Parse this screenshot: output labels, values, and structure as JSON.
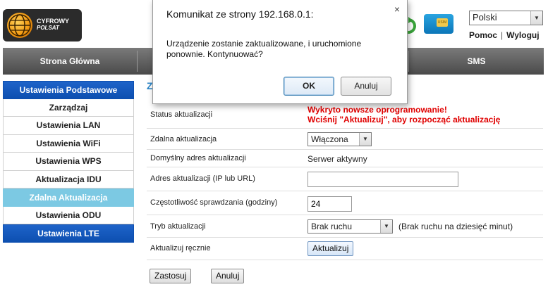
{
  "header": {
    "logo_line1": "CYFROWY",
    "logo_line2": "POLSAT",
    "sim_label": "USIM",
    "language": "Polski",
    "help": "Pomoc",
    "logout": "Wyloguj"
  },
  "nav": {
    "items": [
      {
        "label": "Strona Główna"
      },
      {
        "label": ""
      },
      {
        "label": ""
      },
      {
        "label": "SMS"
      }
    ]
  },
  "sidebar": {
    "items": [
      {
        "label": "Ustawienia Podstawowe",
        "style": "blue"
      },
      {
        "label": "Zarządzaj",
        "style": "normal"
      },
      {
        "label": "Ustawienia LAN",
        "style": "normal"
      },
      {
        "label": "Ustawienia WiFi",
        "style": "normal"
      },
      {
        "label": "Ustawienia WPS",
        "style": "normal"
      },
      {
        "label": "Aktualizacja IDU",
        "style": "normal"
      },
      {
        "label": "Zdalna Aktualizacja",
        "style": "active"
      },
      {
        "label": "Ustawienia ODU",
        "style": "normal"
      },
      {
        "label": "Ustawienia LTE",
        "style": "blue"
      }
    ]
  },
  "content": {
    "heading": "Z",
    "status_label": "Status aktualizacji",
    "status_line1": "Wykryto nowsze oprogramowanie!",
    "status_line2": "Wciśnij \"Aktualizuj\", aby rozpocząć aktualizację",
    "remote_label": "Zdalna aktualizacja",
    "remote_value": "Włączona",
    "default_addr_label": "Domyślny adres aktualizacji",
    "default_addr_value": "Serwer aktywny",
    "addr_label": "Adres aktualizacji (IP lub URL)",
    "addr_value": "",
    "freq_label": "Częstotliwość sprawdzania (godziny)",
    "freq_value": "24",
    "mode_label": "Tryb aktualizacji",
    "mode_value": "Brak ruchu",
    "mode_note": "(Brak ruchu na dziesięć minut)",
    "manual_label": "Aktualizuj ręcznie",
    "manual_button": "Aktualizuj",
    "apply_button": "Zastosuj",
    "cancel_button": "Anuluj"
  },
  "dialog": {
    "title": "Komunikat ze strony 192.168.0.1:",
    "close": "×",
    "message": "Urządzenie zostanie zaktualizowane, i uruchomione ponownie. Kontynuować?",
    "ok": "OK",
    "cancel": "Anuluj"
  },
  "colors": {
    "nav_bg": "#5a5a5a",
    "sidebar_blue": "#0d4fb0",
    "sidebar_active": "#7cc9e3",
    "status_red": "#e00000",
    "heading_blue": "#2a84c6"
  }
}
